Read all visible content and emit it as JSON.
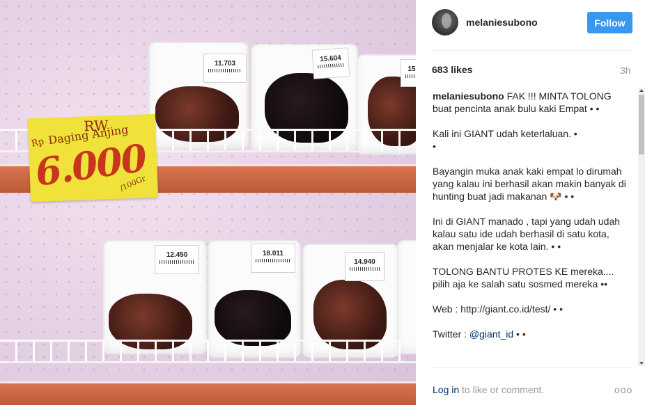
{
  "post": {
    "username": "melaniesubono",
    "follow_label": "Follow",
    "likes": "683 likes",
    "time": "3h",
    "caption": {
      "username": "melaniesubono",
      "p1": "FAK !!! MINTA TOLONG buat pencinta anak bulu kaki Empat • •",
      "p2": "Kali ini GIANT udah keterlaluan. •\n•",
      "p3": "Bayangin muka anak kaki empat lo dirumah yang kalau ini berhasil akan makin banyak di hunting buat jadi makanan 🐶 • •",
      "p4": "Ini di GIANT manado , tapi yang udah udah kalau satu ide udah berhasil di satu kota, akan menjalar ke kota lain. • •",
      "p5": "TOLONG BANTU PROTES KE mereka.... pilih aja ke salah satu sosmed mereka ••",
      "p6": "Web : http://giant.co.id/test/ • •",
      "twitter_prefix": "Twitter : ",
      "twitter_handle": "@giant_id",
      "twitter_suffix": " • •"
    },
    "footer": {
      "login": "Log in",
      "rest": " to like or comment.",
      "more": "ooo"
    }
  },
  "photo": {
    "sign": {
      "rw": "RW",
      "name": "Daging Anjing",
      "rp": "Rp",
      "price": "6.000",
      "weight": "/100Gr"
    },
    "labels": [
      "11.703",
      "15.604",
      "15",
      "12.450",
      "18.011",
      "14.940"
    ]
  }
}
